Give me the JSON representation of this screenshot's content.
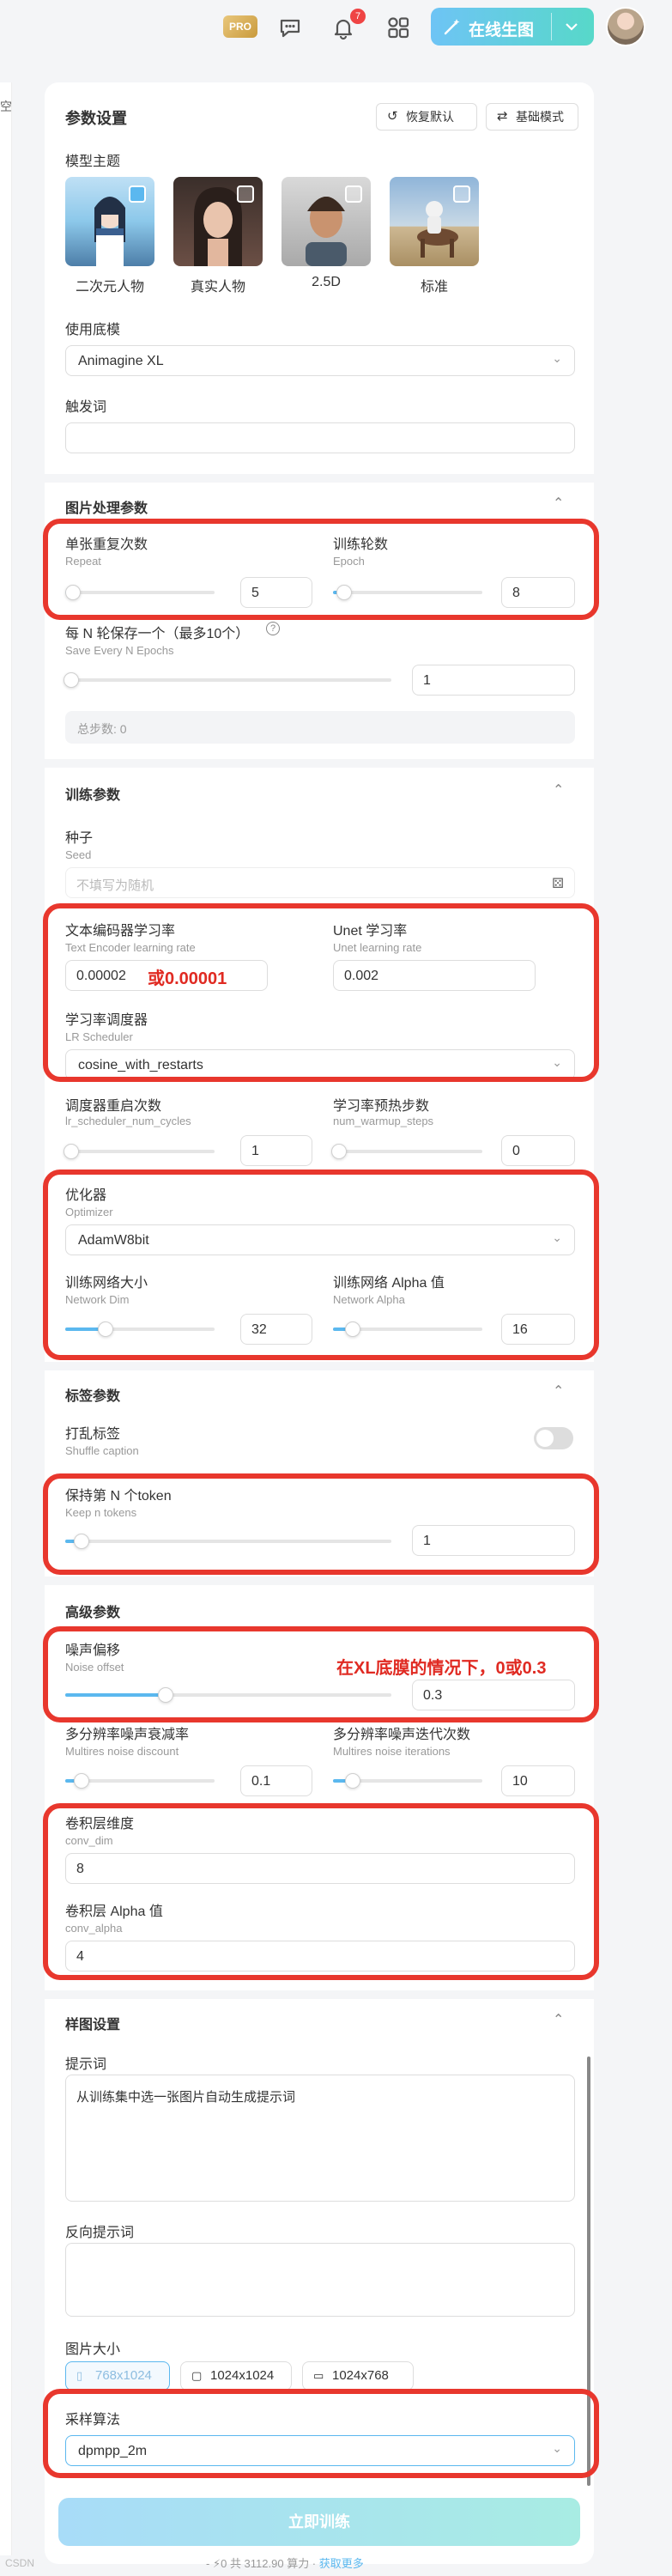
{
  "topbar": {
    "pro_badge": "PRO",
    "notification_count": "7",
    "generate_button": "在线生图"
  },
  "left_strip": {
    "text": "空"
  },
  "panel": {
    "title": "参数设置",
    "restore_default": "恢复默认",
    "basic_mode": "基础模式",
    "model_theme": {
      "label": "模型主题",
      "options": [
        {
          "label": "二次元人物",
          "checked": true
        },
        {
          "label": "真实人物",
          "checked": false
        },
        {
          "label": "2.5D",
          "checked": false
        },
        {
          "label": "标准",
          "checked": false
        }
      ]
    },
    "base_model": {
      "label": "使用底模",
      "value": "Animagine XL"
    },
    "trigger_word": {
      "label": "触发词",
      "value": ""
    },
    "image_section": {
      "title": "图片处理参数",
      "repeat": {
        "label": "单张重复次数",
        "sub": "Repeat",
        "value": "5",
        "level": 0.03
      },
      "epoch": {
        "label": "训练轮数",
        "sub": "Epoch",
        "value": "8",
        "level": 0.07
      },
      "save_every": {
        "label": "每 N 轮保存一个（最多10个）",
        "sub": "Save Every N Epochs",
        "value": "1",
        "level": 0.0
      },
      "total_steps": "总步数: 0"
    },
    "train_section": {
      "title": "训练参数",
      "seed": {
        "label": "种子",
        "sub": "Seed",
        "placeholder": "不填写为随机"
      },
      "te_lr": {
        "label": "文本编码器学习率",
        "sub": "Text Encoder learning rate",
        "value": "0.00002"
      },
      "te_lr_annot": "或0.00001",
      "unet_lr": {
        "label": "Unet 学习率",
        "sub": "Unet learning rate",
        "value": "0.002"
      },
      "scheduler": {
        "label": "学习率调度器",
        "sub": "LR Scheduler",
        "value": "cosine_with_restarts"
      },
      "restart_cycles": {
        "label": "调度器重启次数",
        "sub": "lr_scheduler_num_cycles",
        "value": "1",
        "level": 0.02
      },
      "warmup": {
        "label": "学习率预热步数",
        "sub": "num_warmup_steps",
        "value": "0",
        "level": 0.0
      },
      "optimizer": {
        "label": "优化器",
        "sub": "Optimizer",
        "value": "AdamW8bit"
      },
      "net_dim": {
        "label": "训练网络大小",
        "sub": "Network Dim",
        "value": "32",
        "level": 0.2
      },
      "net_alpha": {
        "label": "训练网络 Alpha 值",
        "sub": "Network Alpha",
        "value": "16",
        "level": 0.12
      }
    },
    "tag_section": {
      "title": "标签参数",
      "shuffle": {
        "label": "打乱标签",
        "sub": "Shuffle caption",
        "on": false
      },
      "keep_tokens": {
        "label": "保持第 N 个token",
        "sub": "Keep n tokens",
        "value": "1",
        "level": 0.05
      }
    },
    "advanced_section": {
      "title": "高级参数",
      "noise_offset": {
        "label": "噪声偏移",
        "sub": "Noise offset",
        "value": "0.3",
        "level": 0.3
      },
      "noise_annot": "在XL底膜的情况下，0或0.3",
      "multires_discount": {
        "label": "多分辨率噪声衰减率",
        "sub": "Multires noise discount",
        "value": "0.1",
        "level": 0.1
      },
      "multires_iter": {
        "label": "多分辨率噪声迭代次数",
        "sub": "Multires noise iterations",
        "value": "10",
        "level": 0.12
      },
      "conv_dim": {
        "label": "卷积层维度",
        "sub": "conv_dim",
        "value": "8"
      },
      "conv_alpha": {
        "label": "卷积层 Alpha 值",
        "sub": "conv_alpha",
        "value": "4"
      }
    },
    "sample_section": {
      "title": "样图设置",
      "prompt": {
        "label": "提示词",
        "value": "从训练集中选一张图片自动生成提示词"
      },
      "negative": {
        "label": "反向提示词",
        "value": ""
      },
      "size": {
        "label": "图片大小",
        "options": [
          "768x1024",
          "1024x1024",
          "1024x768"
        ],
        "selected": "768x1024"
      },
      "sampler": {
        "label": "采样算法",
        "value": "dpmpp_2m"
      }
    }
  },
  "footer": {
    "train_button": "立即训练",
    "cost_prefix": "- ⚡0",
    "cost_text": "共 3112.90 算力 ·",
    "get_more": "获取更多",
    "watermark": "CSDN"
  },
  "colors": {
    "accent": "#5bb8ef",
    "annotation_red": "#e8372d"
  }
}
